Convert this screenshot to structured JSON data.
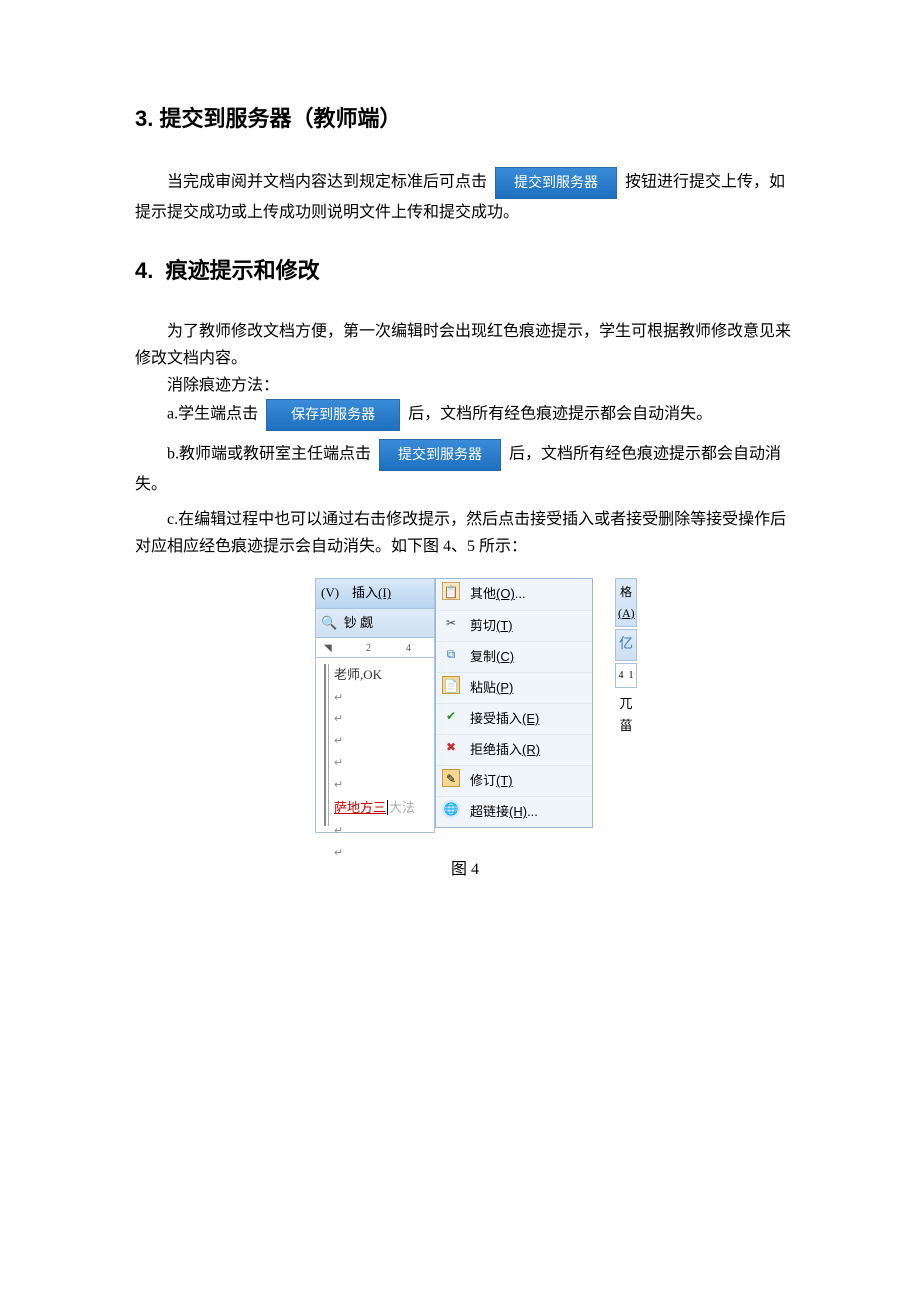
{
  "h3": {
    "num": "3.",
    "title": "提交到服务器（教师端）"
  },
  "p3": {
    "t1": "当完成审阅并文档内容达到规定标准后可点击",
    "btn1": "提交到服务器",
    "t2": "按钮进行提交上传，如提示提交成功或上传成功则说明文件上传和提交成功。"
  },
  "h4": {
    "num": "4.",
    "title": "痕迹提示和修改"
  },
  "p4a": "为了教师修改文档方便，第一次编辑时会出现红色痕迹提示，学生可根据教师修改意见来修改文档内容。",
  "p4b": "消除痕迹方法：",
  "p4c": {
    "pre": "a.学生端点击",
    "btn": "保存到服务器",
    "post": "后，文档所有经色痕迹提示都会自动消失。"
  },
  "p4d": {
    "pre": "b.教师端或教研室主任端点击",
    "btn": "提交到服务器",
    "post": "后，文档所有经色痕迹提示都会自动消失。"
  },
  "p4e": "c.在编辑过程中也可以通过右击修改提示，然后点击接受插入或者接受删除等接受操作后对应相应经色痕迹提示会自动消失。如下图 4、5 所示：",
  "fig4": {
    "menubar": {
      "view": "(V)",
      "insert_label": "插入",
      "insert_key": "(I)"
    },
    "toolbar_chars": "钞  觑",
    "ruler": {
      "n2": "2",
      "n4": "4"
    },
    "doc_text": "老师,OK",
    "red_text": "萨地方三",
    "ghost_text": "大法",
    "menu": {
      "other": {
        "label": "其他",
        "key": "(O)",
        "dots": "..."
      },
      "cut": {
        "label": "剪切",
        "key": "(T)"
      },
      "copy": {
        "label": "复制",
        "key": "(C)"
      },
      "paste": {
        "label": "粘贴",
        "key": "(P)"
      },
      "accept": {
        "label": "接受插入",
        "key": "(E)"
      },
      "reject": {
        "label": "拒绝插入",
        "key": "(R)"
      },
      "revise": {
        "label": "修订",
        "key": "(T)"
      },
      "hyperlink": {
        "label": "超链接",
        "key": "(H)",
        "dots": "..."
      }
    },
    "right": {
      "ge": "格",
      "a": "(A)",
      "sym": "亿",
      "n4": "4",
      "n1": "1",
      "wan": "兀",
      "bi": "菑"
    }
  },
  "caption4": "图 4"
}
